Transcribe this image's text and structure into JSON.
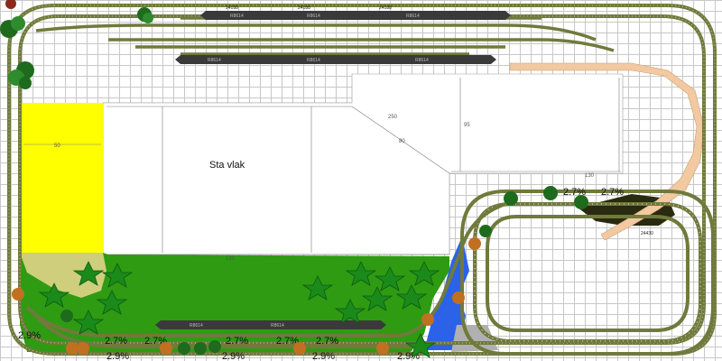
{
  "layout": {
    "room_label": "Sta vlak",
    "dimensions": {
      "d1": "50",
      "d2": "250",
      "d3": "80",
      "d4": "95",
      "d5": "130",
      "d6": "120"
    },
    "track_codes": {
      "straight": "24188",
      "station": "R8614",
      "curve": "24430"
    },
    "grades": {
      "a": "2.7%",
      "b": "2.9%"
    }
  },
  "colors": {
    "track": "#707a3c",
    "sleeper": "#9aa46a",
    "grass": "#2e9b12",
    "yellow": "#ffff00",
    "water": "#2b62e8",
    "platform": "#3a3a3a",
    "dark_green": "#1e6b1e",
    "tan": "#f2c9a0"
  }
}
